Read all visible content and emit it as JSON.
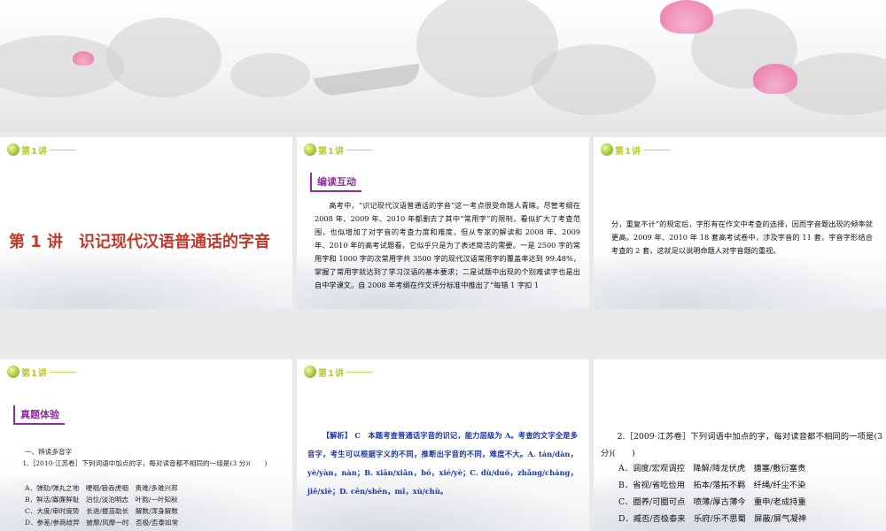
{
  "logo": {
    "text": "第1讲"
  },
  "slide1": {
    "title": "第 1 讲　识记现代汉语普通话的字音"
  },
  "slide2": {
    "tag": "编读互动",
    "body": "高考中，“识记现代汉语普通话的字音”这一考点很受命题人青睐。尽管考纲在 2008 年、2009 年、2010 年都删去了其中“常用字”的限制，看似扩大了考查范围，也似增加了对字音的考查力度和难度，但从专家的解读和 2008 年、2009 年、2010 年的高考试题看，它似乎只是为了表述简洁的需要。一是 2500 字的常用字和 1000 字的次常用字共 3500 字的现代汉语常用字的覆盖率达到 99.48%，掌握了常用字就达到了学习汉语的基本要求；二是试题中出现的个别难读字也是出自中学课文。自 2008 年考纲在作文评分标准中推出了“每错 1 字扣 1"
  },
  "slide3": {
    "body": "分，重复不计”的规定后，字形有在作文中考查的选择，因而字音题出现的频率就更高。2009 年、2010 年 18 套高考试卷中，涉及字音的 11 套，字音字形结合考查的 2 套，这就足以说明命题人对字音题的重视。"
  },
  "slide4": {
    "tag": "真题体验",
    "section": "一、辨读多音字",
    "question": "1.［2010·江苏卷］下列词语中加点的字，每对读音都不相同的一组是(3 分)(　　)",
    "options": [
      "A．弹劾/弹丸之地　哽咽/狼吞虎咽　责难/多难兴邦",
      "B．鲜活/寡廉鲜耻　泊位/淡泊明志　叶韵/一叶知秋",
      "C．大度/审时度势　长进/揠苗助长　解数/浑身解数",
      "D．参差/参商歧异　披靡/风靡一时　否极/否泰如常"
    ]
  },
  "slide5": {
    "answer": "【解析】 C　本题考查普通话字音的识记，能力层级为 A。考查的文字全是多音字，考生可以根据字义的不同，推断出字音的不同，难度不大。A. tán/dàn，yè/yàn，nàn；B. xiān/xiǎn，bó，xié/yè；C. dù/duó，zhǎng/cháng，jiě/xiè；D. cēn/shēn，mǐ，xù/chù。"
  },
  "slide6": {
    "question": "2.［2009·江苏卷］下列词语中加点的字，每对读音都不相同的一项是(3 分)(　　)",
    "options": [
      "A．调度/宏观调控　降解/降龙伏虎　搪塞/敷衍塞责",
      "B．省视/省吃俭用　拓本/落拓不羁　纤绳/纤尘不染",
      "C．圈养/可圈可点　喷薄/厚古薄今　重申/老成持重",
      "D．臧否/否极泰来　乐府/乐不思蜀　屏蔽/屏气凝神"
    ]
  },
  "colors": {
    "title_red": "#c0392b",
    "tag_purple": "#8e2f9a",
    "answer_blue": "#1a35a8"
  }
}
